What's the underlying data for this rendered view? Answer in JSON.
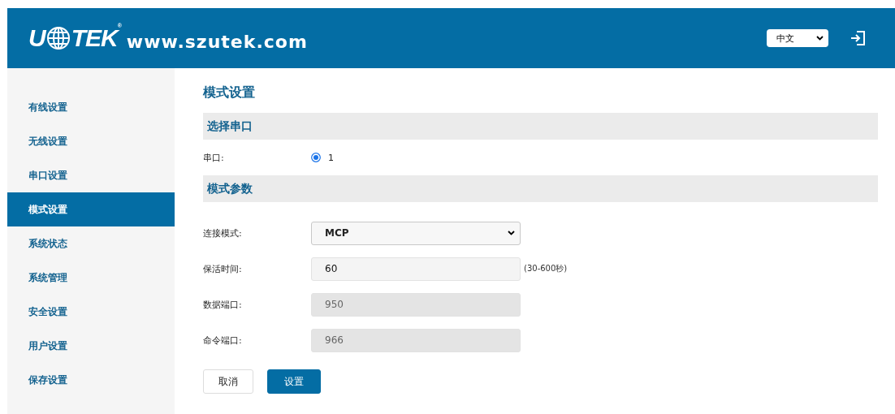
{
  "header": {
    "logo": {
      "before": "U",
      "after": "TEK",
      "mark": "®"
    },
    "website": "www.szutek.com",
    "language": {
      "value": "中文"
    }
  },
  "sidebar": {
    "items": [
      {
        "label": "有线设置",
        "selected": false
      },
      {
        "label": "无线设置",
        "selected": false
      },
      {
        "label": "串口设置",
        "selected": false
      },
      {
        "label": "模式设置",
        "selected": true
      },
      {
        "label": "系统状态",
        "selected": false
      },
      {
        "label": "系统管理",
        "selected": false
      },
      {
        "label": "安全设置",
        "selected": false
      },
      {
        "label": "用户设置",
        "selected": false
      },
      {
        "label": "保存设置",
        "selected": false
      }
    ]
  },
  "page_title": "模式设置",
  "sections": [
    {
      "title": "选择串口",
      "rows": [
        {
          "kind": "radio",
          "label": "串口:",
          "options": [
            {
              "label": "1",
              "selected": true
            }
          ]
        }
      ]
    },
    {
      "title": "模式参数",
      "rows": [
        {
          "kind": "select",
          "label": "连接模式:",
          "value": "MCP"
        },
        {
          "kind": "input",
          "label": "保活时间:",
          "value": "60",
          "disabled": false,
          "hint": "(30-600秒)"
        },
        {
          "kind": "input",
          "label": "数据端口:",
          "value": "950",
          "disabled": true
        },
        {
          "kind": "input",
          "label": "命令端口:",
          "value": "966",
          "disabled": true
        }
      ]
    }
  ],
  "buttons": [
    {
      "label": "取消",
      "kind": "secondary"
    },
    {
      "label": "设置",
      "kind": "primary"
    }
  ]
}
